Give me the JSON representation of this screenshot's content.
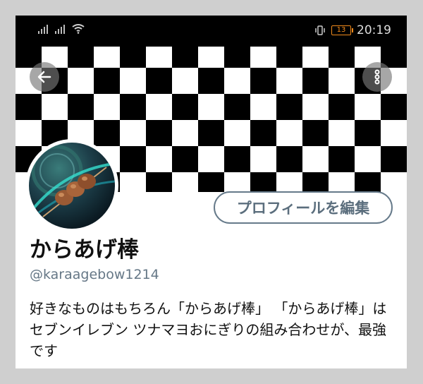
{
  "status_bar": {
    "time": "20:19",
    "battery_level": "13",
    "icons": [
      "signal-icon",
      "signal-icon",
      "wifi-icon",
      "vibrate-icon",
      "battery-icon"
    ]
  },
  "header": {
    "back_icon": "arrow-left-icon",
    "more_icon": "more-vertical-icon",
    "banner_pattern": "black-white-checkerboard"
  },
  "profile": {
    "edit_button_label": "プロフィールを編集",
    "display_name": "からあげ棒",
    "handle": "@karaagebow1214",
    "bio": "好きなものはもちろん「からあげ棒」 「からあげ棒」はセブンイレブン ツナマヨおにぎりの組み合わせが、最強です"
  },
  "colors": {
    "edit_button_border": "#667a8a",
    "handle_text": "#657786",
    "battery_accent": "#f08a1c"
  }
}
